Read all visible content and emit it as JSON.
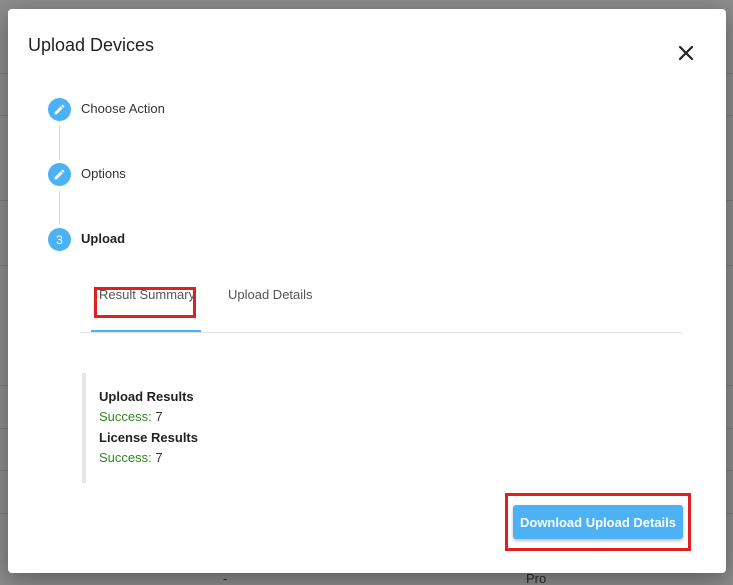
{
  "dialog": {
    "title": "Upload Devices"
  },
  "stepper": {
    "steps": [
      {
        "label": "Choose Action",
        "icon": "pencil-icon",
        "state": "completed"
      },
      {
        "label": "Options",
        "icon": "pencil-icon",
        "state": "completed"
      },
      {
        "label": "Upload",
        "number": "3",
        "state": "active"
      }
    ]
  },
  "tabs": [
    {
      "label": "Result Summary",
      "selected": true
    },
    {
      "label": "Upload Details",
      "selected": false
    }
  ],
  "results": {
    "upload_heading": "Upload Results",
    "upload_success_label": "Success:",
    "upload_success_value": "7",
    "license_heading": "License Results",
    "license_success_label": "Success:",
    "license_success_value": "7"
  },
  "actions": {
    "download_label": "Download Upload Details"
  },
  "background": {
    "bottom_left_text": "-",
    "bottom_right_text": "Pro"
  },
  "colors": {
    "accent": "#4db1f5",
    "success": "#2e8b1f",
    "highlight": "#e02020"
  }
}
